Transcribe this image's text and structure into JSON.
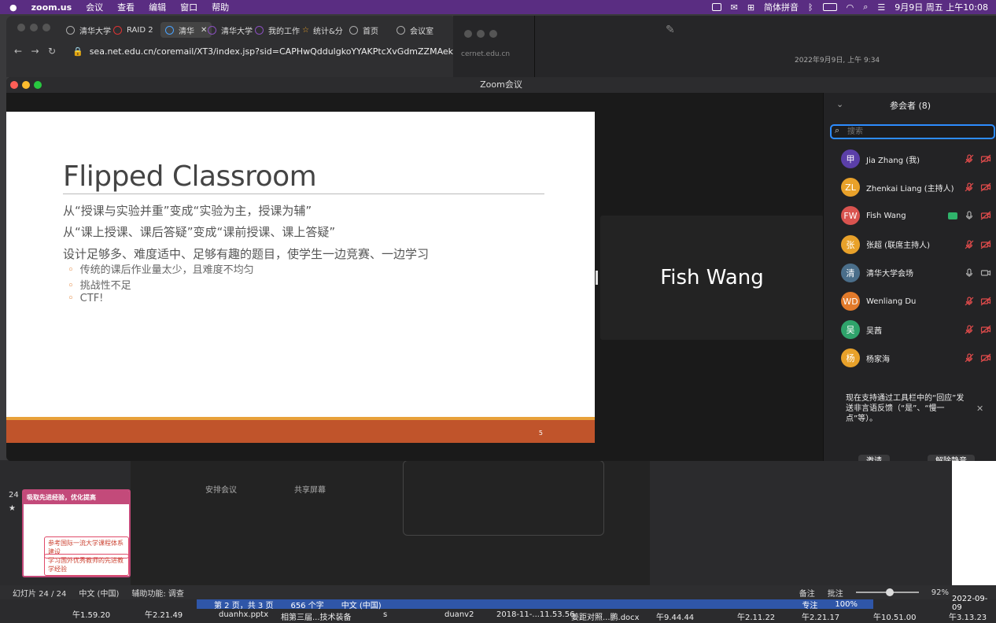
{
  "menubar": {
    "app": "zoom.us",
    "items": [
      "会议",
      "查看",
      "编辑",
      "窗口",
      "帮助"
    ],
    "input_method": "简体拼音",
    "datetime": "9月9日 周五 上午10:08"
  },
  "browser": {
    "tabs": [
      "清华大学",
      "RAID 2",
      "清华",
      "清华大学",
      "我的工作",
      "统计&分",
      "首页",
      "会议室"
    ],
    "url": "sea.net.edu.cn/coremail/XT3/index.jsp?sid=CAPHwQddulgkoYYAKPtcXvGdmZZMAekQ#/md="
  },
  "notes": {
    "sidebar_text": "cernet.edu.cn",
    "date_line": "2022年9月9日, 上午 9:34"
  },
  "zoom": {
    "title": "Zoom会议",
    "slide": {
      "title": "Flipped Classroom",
      "lines": [
        "从“授课与实验并重”变成“实验为主，授课为辅”",
        "从“课上授课、课后答疑”变成“课前授课、课上答疑”",
        "设计足够多、难度适中、足够有趣的题目，使学生一边竞赛、一边学习"
      ],
      "bullets": [
        "传统的课后作业量太少，且难度不均匀",
        "挑战性不足",
        "CTF!"
      ],
      "page_number": "5"
    },
    "speaker_name": "Fish Wang",
    "participants_panel": {
      "header": "参会者 (8)",
      "search_placeholder": "搜索",
      "participants": [
        {
          "initials": "甲",
          "name": "Jia Zhang (我)",
          "color": "#5b3fa8"
        },
        {
          "initials": "ZL",
          "name": "Zhenkai Liang (主持人)",
          "color": "#e8a12a"
        },
        {
          "initials": "FW",
          "name": "Fish Wang",
          "color": "#d9534f"
        },
        {
          "initials": "张",
          "name": "张超 (联席主持人)",
          "color": "#e8a12a"
        },
        {
          "initials": "清",
          "name": "清华大学会场",
          "color": "#4a6e8a"
        },
        {
          "initials": "WD",
          "name": "Wenliang Du",
          "color": "#e27a2a"
        },
        {
          "initials": "吴",
          "name": "吴茜",
          "color": "#2fa36b"
        },
        {
          "initials": "杨",
          "name": "杨家海",
          "color": "#e8a12a"
        }
      ],
      "tip": "现在支持通过工具栏中的“回应”发送非言语反馈（“是”、“慢一点”等）。",
      "invite_button": "邀请",
      "unmute_button": "解除静音"
    }
  },
  "background": {
    "schedule_meeting": "安排会议",
    "share_screen": "共享屏幕",
    "slide_index": "24",
    "thumb_title": "吸取先进经验，优化提高",
    "thumb_box1": "参考国际一流大学课程体系建设",
    "thumb_box2": "学习国外优秀教师的先进教学经验",
    "ppt_status": {
      "slide": "幻灯片 24 / 24",
      "lang": "中文 (中国)",
      "access": "辅助功能: 调查",
      "notes": "备注",
      "comments": "批注",
      "zoom": "92%"
    },
    "word_status": {
      "page": "第 2 页，共 3 页",
      "words": "656 个字",
      "lang": "中文 (中国)",
      "focus": "专注",
      "zoom": "100%"
    },
    "files": [
      "duanhx.pptx",
      "相第三届...技术装备",
      "s",
      "duanv2",
      "2018-11-...11.53.56",
      "姜距对照...鹏.docx"
    ],
    "times": [
      "午1.59.20",
      "午2.21.49",
      "午9.44.44",
      "午2.11.22",
      "午2.21.17",
      "午10.51.00",
      "午3.13.23"
    ],
    "date_label": "2022-09-09"
  }
}
